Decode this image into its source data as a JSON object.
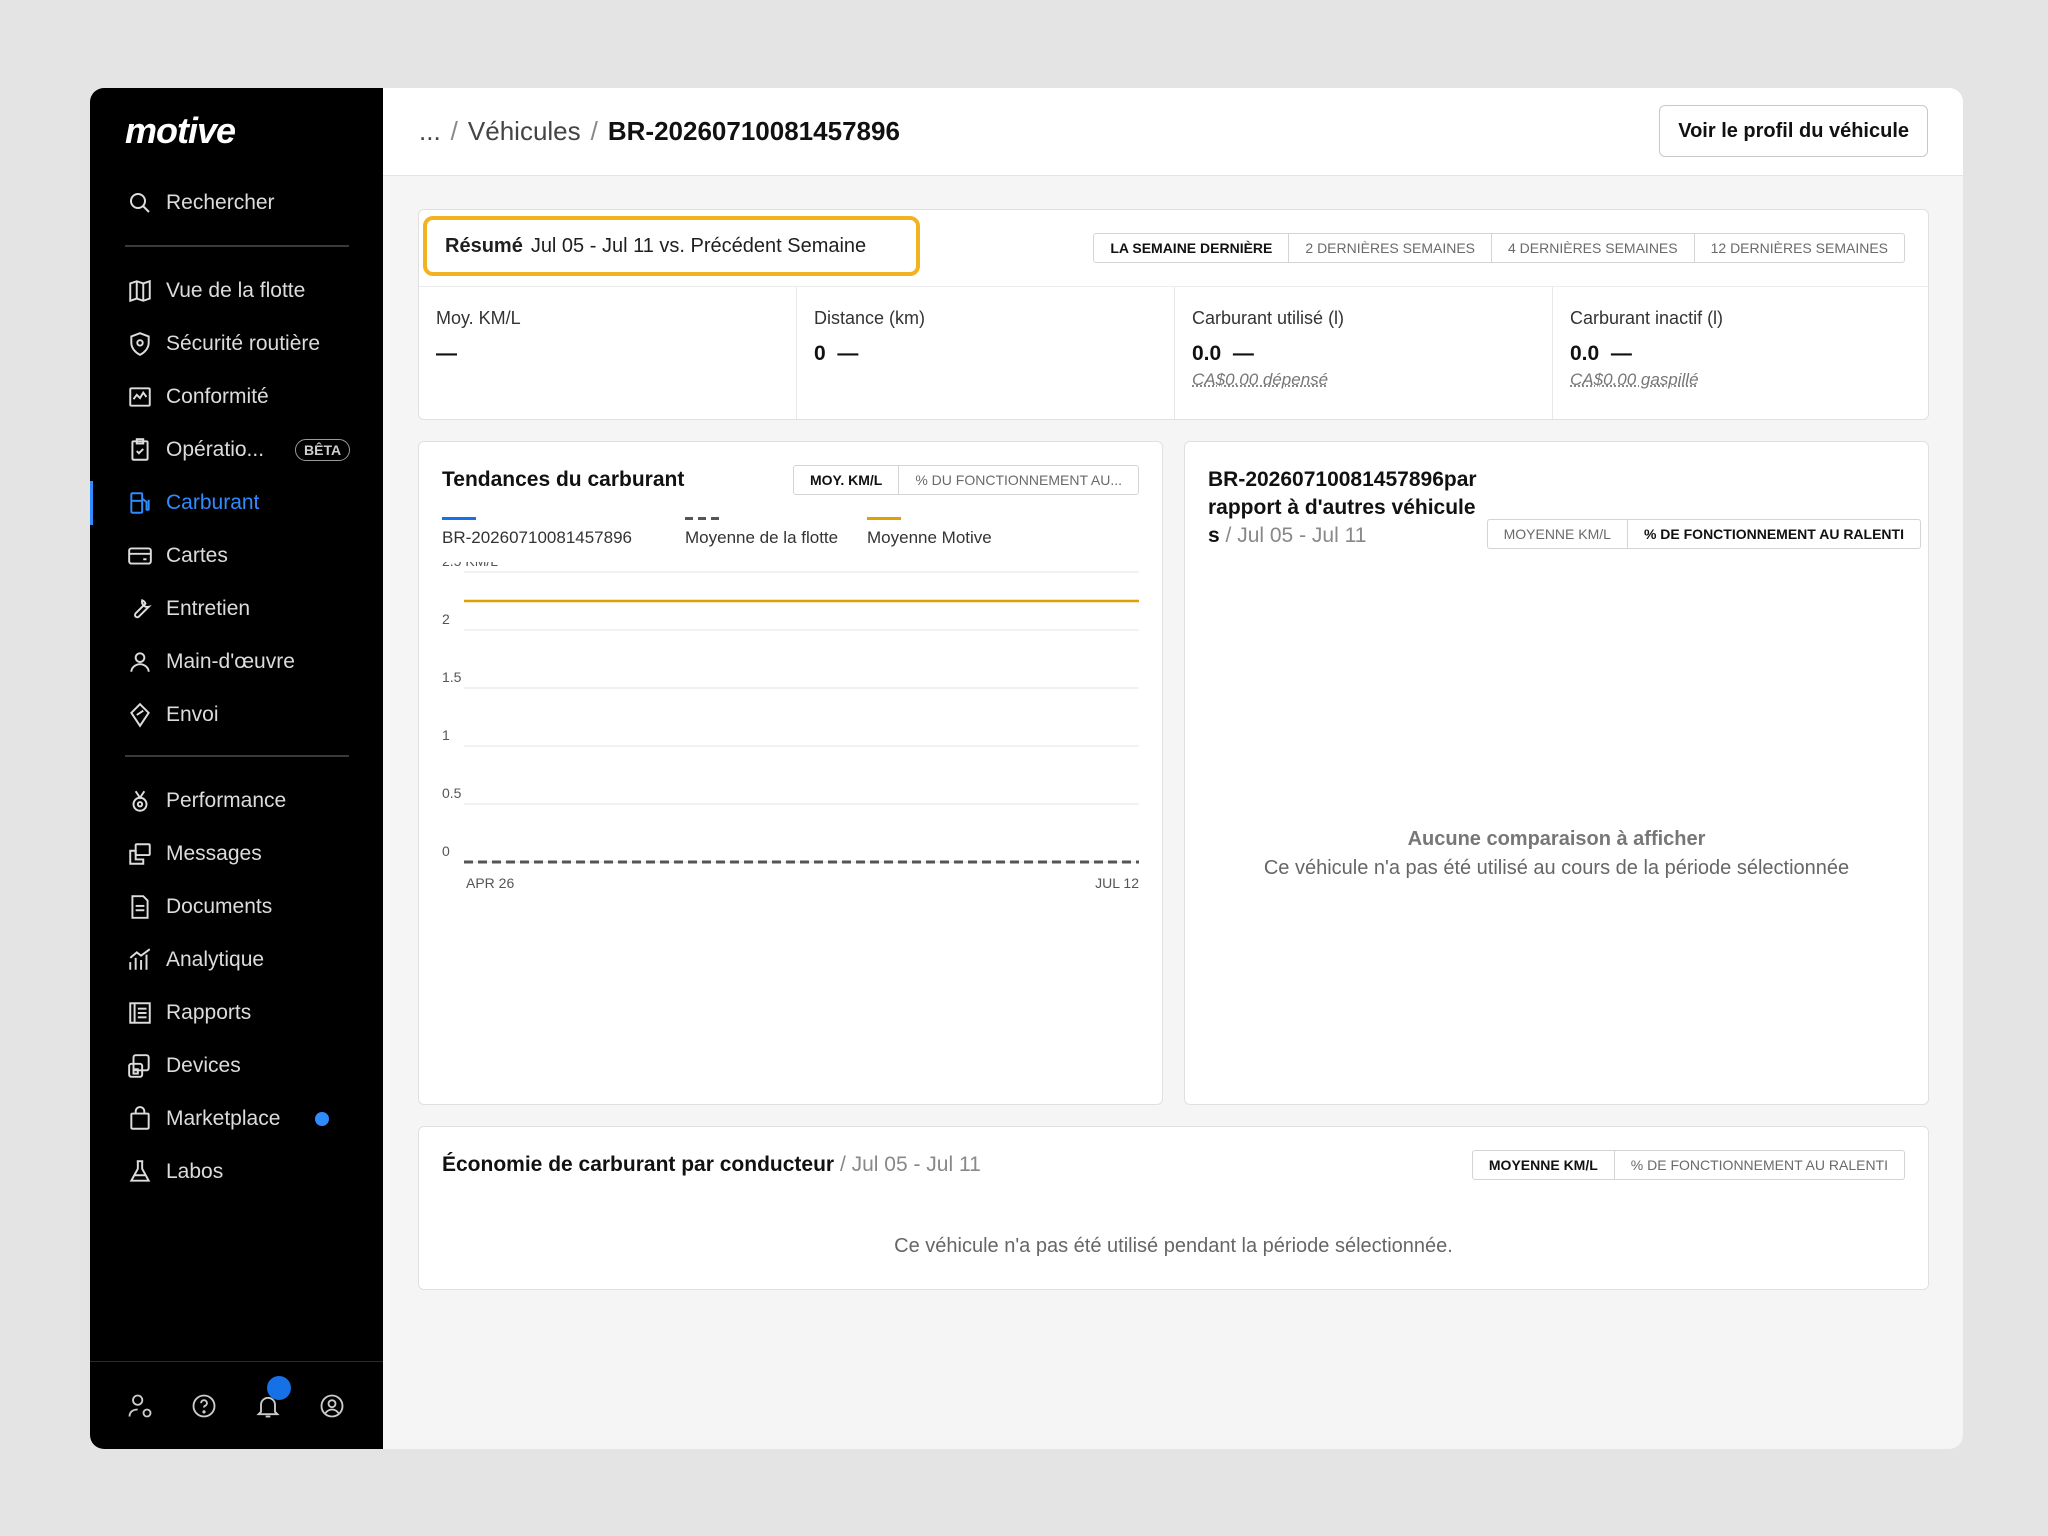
{
  "sidebar": {
    "logo": "motive",
    "search": "Rechercher",
    "items": [
      {
        "label": "Vue de la flotte"
      },
      {
        "label": "Sécurité routière"
      },
      {
        "label": "Conformité"
      },
      {
        "label": "Opératio...",
        "badge": "BÊTA"
      },
      {
        "label": "Carburant"
      },
      {
        "label": "Cartes"
      },
      {
        "label": "Entretien"
      },
      {
        "label": "Main-d'œuvre"
      },
      {
        "label": "Envoi"
      }
    ],
    "items2": [
      {
        "label": "Performance"
      },
      {
        "label": "Messages"
      },
      {
        "label": "Documents"
      },
      {
        "label": "Analytique"
      },
      {
        "label": "Rapports"
      },
      {
        "label": "Devices"
      },
      {
        "label": "Marketplace"
      },
      {
        "label": "Labos"
      }
    ],
    "accent": "#2f8cff"
  },
  "header": {
    "crumb_ellipsis": "...",
    "crumb_vehicles": "Véhicules",
    "crumb_current": "BR-20260710081457896",
    "profile_button": "Voir le profil du véhicule"
  },
  "summary": {
    "title": "Résumé",
    "range": "Jul 05 - Jul 11 vs. Précédent Semaine",
    "tabs": [
      "LA SEMAINE DERNIÈRE",
      "2 DERNIÈRES SEMAINES",
      "4 DERNIÈRES SEMAINES",
      "12 DERNIÈRES SEMAINES"
    ],
    "metrics": [
      {
        "label": "Moy. KM/L",
        "value": "—",
        "sub": ""
      },
      {
        "label": "Distance (km)",
        "value": "0  —",
        "sub": ""
      },
      {
        "label": "Carburant utilisé (l)",
        "value": "0.0  —",
        "sub": "CA$0.00 dépensé"
      },
      {
        "label": "Carburant inactif (l)",
        "value": "0.0  —",
        "sub": "CA$0.00 gaspillé"
      }
    ],
    "highlight_color": "#f2b323"
  },
  "trends": {
    "title": "Tendances du carburant",
    "tabs": [
      "MOY. KM/L",
      "% DU FONCTIONNEMENT AU..."
    ],
    "legend": [
      "BR-20260710081457896",
      "Moyenne de la flotte",
      "Moyenne Motive"
    ]
  },
  "chart_data": {
    "type": "line",
    "x": [
      "APR 26",
      "JUL 12"
    ],
    "ylabel": "KM/L",
    "y_ticks": [
      "2.5 KM/L",
      "2",
      "1.5",
      "1",
      "0.5",
      "0"
    ],
    "ylim": [
      0,
      2.5
    ],
    "series": [
      {
        "name": "BR-20260710081457896",
        "values": [],
        "color": "#1670e6"
      },
      {
        "name": "Moyenne de la flotte",
        "values": [
          0,
          0
        ],
        "color": "#555555",
        "style": "dashed"
      },
      {
        "name": "Moyenne Motive",
        "values": [
          2.25,
          2.25
        ],
        "color": "#e0a000"
      }
    ]
  },
  "compare": {
    "title": "BR-20260710081457896par rapport à d'autres véhicules",
    "range": "/ Jul 05 - Jul 11",
    "tabs": [
      "MOYENNE KM/L",
      "% DE FONCTIONNEMENT AU RALENTI"
    ],
    "empty_title": "Aucune comparaison à afficher",
    "empty_sub": "Ce véhicule n'a pas été utilisé au cours de la période sélectionnée"
  },
  "drivers": {
    "title": "Économie de carburant par conducteur",
    "range": "/ Jul 05 - Jul 11",
    "tabs": [
      "MOYENNE KM/L",
      "% DE FONCTIONNEMENT AU RALENTI"
    ],
    "empty": "Ce véhicule n'a pas été utilisé pendant la période sélectionnée."
  }
}
